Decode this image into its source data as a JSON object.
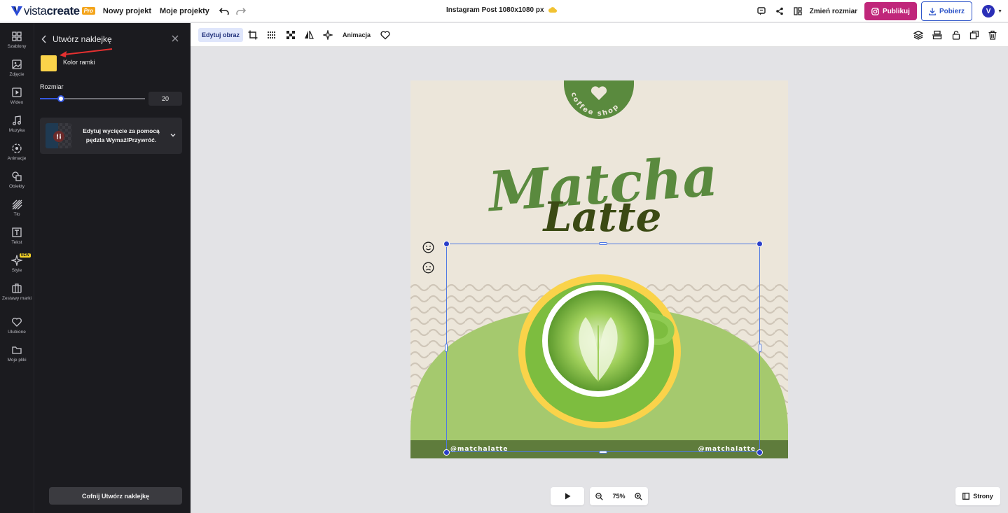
{
  "header": {
    "logo_text_light": "vista",
    "logo_text_bold": "create",
    "pro_badge": "Pro",
    "new_project": "Nowy projekt",
    "my_projects": "Moje projekty",
    "doc_title": "Instagram Post 1080x1080 px",
    "resize": "Zmień rozmiar",
    "publish": "Publikuj",
    "download": "Pobierz",
    "avatar_initial": "V"
  },
  "leftnav": {
    "items": [
      {
        "label": "Szablony",
        "icon": "grid-icon"
      },
      {
        "label": "Zdjęcie",
        "icon": "image-icon"
      },
      {
        "label": "Wideo",
        "icon": "video-icon"
      },
      {
        "label": "Muzyka",
        "icon": "music-icon"
      },
      {
        "label": "Animacje",
        "icon": "animation-icon"
      },
      {
        "label": "Obiekty",
        "icon": "objects-icon"
      },
      {
        "label": "Tło",
        "icon": "background-icon"
      },
      {
        "label": "Tekst",
        "icon": "text-icon"
      },
      {
        "label": "Style",
        "icon": "sparkle-icon"
      },
      {
        "label": "Zestawy marki",
        "icon": "briefcase-icon"
      },
      {
        "label": "Ulubione",
        "icon": "heart-icon"
      },
      {
        "label": "Moje pliki",
        "icon": "folder-icon"
      }
    ],
    "new_badge": "NEW"
  },
  "panel": {
    "title": "Utwórz naklejkę",
    "frame_color_label": "Kolor ramki",
    "frame_color": "#fad34a",
    "size_label": "Rozmiar",
    "size_value": "20",
    "size_fraction": 0.2,
    "tool_card_text": "Edytuj wycięcie za pomocą pędzla Wymaż/Przywróć.",
    "undo_button": "Cofnij Utwórz naklejkę"
  },
  "toolbar": {
    "edit_image": "Edytuj obraz",
    "animation": "Animacja"
  },
  "canvas": {
    "badge_text": "coffee shop",
    "title_line1": "Matcha",
    "title_line2": "Latte",
    "handle_left": "@matchalatte",
    "handle_right": "@matchalatte",
    "accent_green": "#5a8a3e",
    "dark_green": "#3b4a14",
    "light_green": "#a5c96e"
  },
  "bottom": {
    "zoom": "75%",
    "pages": "Strony"
  }
}
